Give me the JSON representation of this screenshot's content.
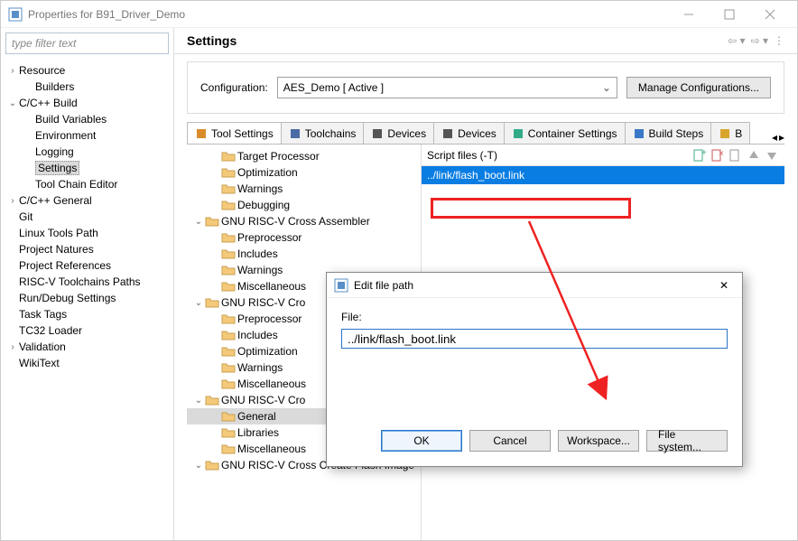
{
  "window": {
    "title": "Properties for B91_Driver_Demo"
  },
  "filter": {
    "placeholder": "type filter text"
  },
  "leftTree": [
    {
      "label": "Resource",
      "depth": 0,
      "arrow": "right"
    },
    {
      "label": "Builders",
      "depth": 1,
      "arrow": "none"
    },
    {
      "label": "C/C++ Build",
      "depth": 0,
      "arrow": "down"
    },
    {
      "label": "Build Variables",
      "depth": 1,
      "arrow": "none"
    },
    {
      "label": "Environment",
      "depth": 1,
      "arrow": "none"
    },
    {
      "label": "Logging",
      "depth": 1,
      "arrow": "none"
    },
    {
      "label": "Settings",
      "depth": 1,
      "arrow": "none",
      "selected": true
    },
    {
      "label": "Tool Chain Editor",
      "depth": 1,
      "arrow": "none"
    },
    {
      "label": "C/C++ General",
      "depth": 0,
      "arrow": "right"
    },
    {
      "label": "Git",
      "depth": 0,
      "arrow": "none"
    },
    {
      "label": "Linux Tools Path",
      "depth": 0,
      "arrow": "none"
    },
    {
      "label": "Project Natures",
      "depth": 0,
      "arrow": "none"
    },
    {
      "label": "Project References",
      "depth": 0,
      "arrow": "none"
    },
    {
      "label": "RISC-V Toolchains Paths",
      "depth": 0,
      "arrow": "none"
    },
    {
      "label": "Run/Debug Settings",
      "depth": 0,
      "arrow": "none"
    },
    {
      "label": "Task Tags",
      "depth": 0,
      "arrow": "none"
    },
    {
      "label": "TC32 Loader",
      "depth": 0,
      "arrow": "none"
    },
    {
      "label": "Validation",
      "depth": 0,
      "arrow": "right"
    },
    {
      "label": "WikiText",
      "depth": 0,
      "arrow": "none"
    }
  ],
  "header": {
    "title": "Settings"
  },
  "config": {
    "label": "Configuration:",
    "value": "AES_Demo  [ Active ]",
    "manageButton": "Manage Configurations..."
  },
  "tabs": [
    {
      "label": "Tool Settings",
      "active": true,
      "icon": "wrench"
    },
    {
      "label": "Toolchains",
      "icon": "gear"
    },
    {
      "label": "Devices",
      "icon": "chip"
    },
    {
      "label": "Devices",
      "icon": "chip"
    },
    {
      "label": "Container Settings",
      "icon": "container"
    },
    {
      "label": "Build Steps",
      "icon": "steps"
    },
    {
      "label": "B",
      "icon": "artifact"
    }
  ],
  "settingsTree": [
    {
      "label": "Target Processor",
      "depth": 1,
      "arrow": "none"
    },
    {
      "label": "Optimization",
      "depth": 1,
      "arrow": "none"
    },
    {
      "label": "Warnings",
      "depth": 1,
      "arrow": "none"
    },
    {
      "label": "Debugging",
      "depth": 1,
      "arrow": "none"
    },
    {
      "label": "GNU RISC-V Cross Assembler",
      "depth": 0,
      "arrow": "down"
    },
    {
      "label": "Preprocessor",
      "depth": 1,
      "arrow": "none"
    },
    {
      "label": "Includes",
      "depth": 1,
      "arrow": "none"
    },
    {
      "label": "Warnings",
      "depth": 1,
      "arrow": "none"
    },
    {
      "label": "Miscellaneous",
      "depth": 1,
      "arrow": "none"
    },
    {
      "label": "GNU RISC-V Cro",
      "depth": 0,
      "arrow": "down"
    },
    {
      "label": "Preprocessor",
      "depth": 1,
      "arrow": "none"
    },
    {
      "label": "Includes",
      "depth": 1,
      "arrow": "none"
    },
    {
      "label": "Optimization",
      "depth": 1,
      "arrow": "none"
    },
    {
      "label": "Warnings",
      "depth": 1,
      "arrow": "none"
    },
    {
      "label": "Miscellaneous",
      "depth": 1,
      "arrow": "none"
    },
    {
      "label": "GNU RISC-V Cro",
      "depth": 0,
      "arrow": "down"
    },
    {
      "label": "General",
      "depth": 1,
      "arrow": "none",
      "selected": true
    },
    {
      "label": "Libraries",
      "depth": 1,
      "arrow": "none"
    },
    {
      "label": "Miscellaneous",
      "depth": 1,
      "arrow": "none"
    },
    {
      "label": "GNU RISC-V Cross Create Flash Image",
      "depth": 0,
      "arrow": "down"
    }
  ],
  "scriptPanel": {
    "title": "Script files (-T)",
    "item": "../link/flash_boot.link"
  },
  "modal": {
    "title": "Edit file path",
    "fieldLabel": "File:",
    "fieldValue": "../link/flash_boot.link",
    "buttons": {
      "ok": "OK",
      "cancel": "Cancel",
      "workspace": "Workspace...",
      "filesystem": "File system..."
    }
  }
}
